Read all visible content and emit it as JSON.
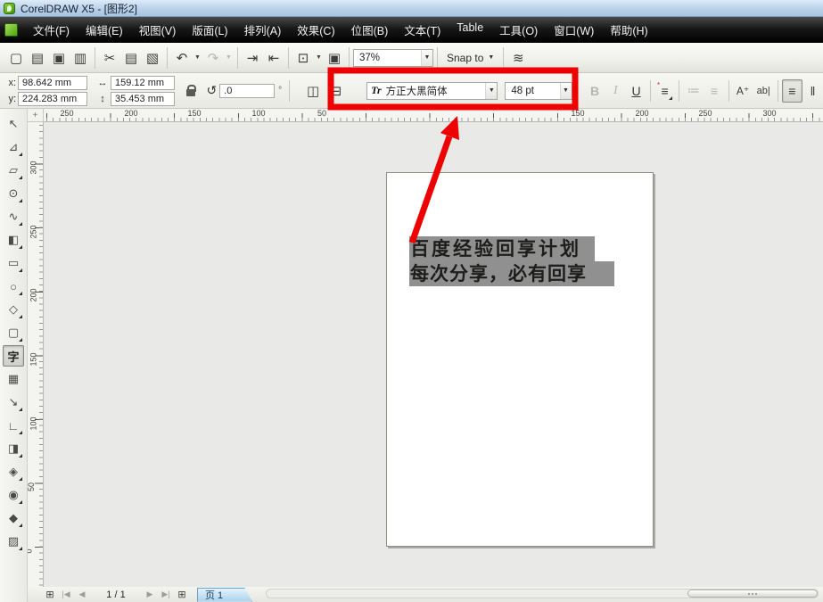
{
  "title_bar": {
    "title": "CorelDRAW X5 - [图形2]"
  },
  "menu_bar": {
    "items": [
      "文件(F)",
      "编辑(E)",
      "视图(V)",
      "版面(L)",
      "排列(A)",
      "效果(C)",
      "位图(B)",
      "文本(T)",
      "Table",
      "工具(O)",
      "窗口(W)",
      "帮助(H)"
    ]
  },
  "toolbar": {
    "zoom_value": "37%",
    "snap_label": "Snap to"
  },
  "property_bar": {
    "x_label": "x:",
    "x_value": "98.642 mm",
    "y_label": "y:",
    "y_value": "224.283 mm",
    "width_value": "159.12 mm",
    "height_value": "35.453 mm",
    "rotation_value": ".0",
    "rotation_unit": "°",
    "font_name": "方正大黑简体",
    "font_size_value": "48 pt"
  },
  "rulers": {
    "horizontal_labels": [
      "250",
      "200",
      "150",
      "100",
      "50",
      "150",
      "200",
      "250",
      "300"
    ],
    "vertical_labels": [
      "300",
      "250",
      "200",
      "150",
      "100",
      "50",
      "0"
    ],
    "units_label": "millimeters"
  },
  "toolbox": {
    "tools": [
      {
        "name": "pick-tool",
        "glyph": "↖",
        "pressed": false,
        "flyout": false
      },
      {
        "name": "shape-tool",
        "glyph": "⊿",
        "pressed": false,
        "flyout": true
      },
      {
        "name": "crop-tool",
        "glyph": "▱",
        "pressed": false,
        "flyout": true
      },
      {
        "name": "zoom-tool",
        "glyph": "⊙",
        "pressed": false,
        "flyout": true
      },
      {
        "name": "freehand-tool",
        "glyph": "∿",
        "pressed": false,
        "flyout": true
      },
      {
        "name": "smart-fill-tool",
        "glyph": "◧",
        "pressed": false,
        "flyout": true
      },
      {
        "name": "rectangle-tool",
        "glyph": "▭",
        "pressed": false,
        "flyout": true
      },
      {
        "name": "ellipse-tool",
        "glyph": "○",
        "pressed": false,
        "flyout": true
      },
      {
        "name": "polygon-tool",
        "glyph": "◇",
        "pressed": false,
        "flyout": true
      },
      {
        "name": "basic-shapes-tool",
        "glyph": "▢",
        "pressed": false,
        "flyout": true
      },
      {
        "name": "text-tool",
        "glyph": "字",
        "pressed": true,
        "flyout": false
      },
      {
        "name": "table-tool",
        "glyph": "▦",
        "pressed": false,
        "flyout": false
      },
      {
        "name": "dimension-tool",
        "glyph": "↘",
        "pressed": false,
        "flyout": true
      },
      {
        "name": "connector-tool",
        "glyph": "∟",
        "pressed": false,
        "flyout": true
      },
      {
        "name": "blend-tool",
        "glyph": "◨",
        "pressed": false,
        "flyout": true
      },
      {
        "name": "eyedropper-tool",
        "glyph": "◈",
        "pressed": false,
        "flyout": true
      },
      {
        "name": "outline-pen-tool",
        "glyph": "◉",
        "pressed": false,
        "flyout": true
      },
      {
        "name": "fill-tool",
        "glyph": "◆",
        "pressed": false,
        "flyout": true
      },
      {
        "name": "interactive-fill-tool",
        "glyph": "▨",
        "pressed": false,
        "flyout": true
      }
    ]
  },
  "canvas": {
    "page_text": [
      "百度经验回享计划",
      "每次分享，必有回享"
    ]
  },
  "status_bar": {
    "page_indicator": "1 / 1",
    "page_tab_label": "页 1"
  },
  "icons": {
    "new": "▢",
    "open": "▤",
    "save": "▣",
    "print": "▥",
    "cut": "✂",
    "copy": "▤",
    "paste": "▧",
    "undo": "↶",
    "redo": "↷",
    "import": "⇥",
    "export": "⇤",
    "app_launcher": "⊡",
    "welcome_screen": "▣",
    "dropdown": "▼",
    "options": "≋",
    "width": "↔",
    "height": "↕",
    "rotation": "↺",
    "mirror_h": "◫",
    "mirror_v": "⊟",
    "truetype": "Tr",
    "bold": "B",
    "italic": "I",
    "underline": "U",
    "align": "≡",
    "red_star": "*",
    "bullets": "≔",
    "indent": "≡",
    "char_formatting": "A⁺",
    "edit_text": "ab|",
    "h_text": "≡",
    "v_text": "‖",
    "add_page": "⊞",
    "first_page": "|◀",
    "prev_page": "◀",
    "next_page": "▶",
    "last_page": "▶|",
    "ruler_origin": "+"
  },
  "colors": {
    "highlight_red": "#ee0000",
    "selection_gray": "#909090",
    "tab_blue": "#a9d2ee"
  }
}
